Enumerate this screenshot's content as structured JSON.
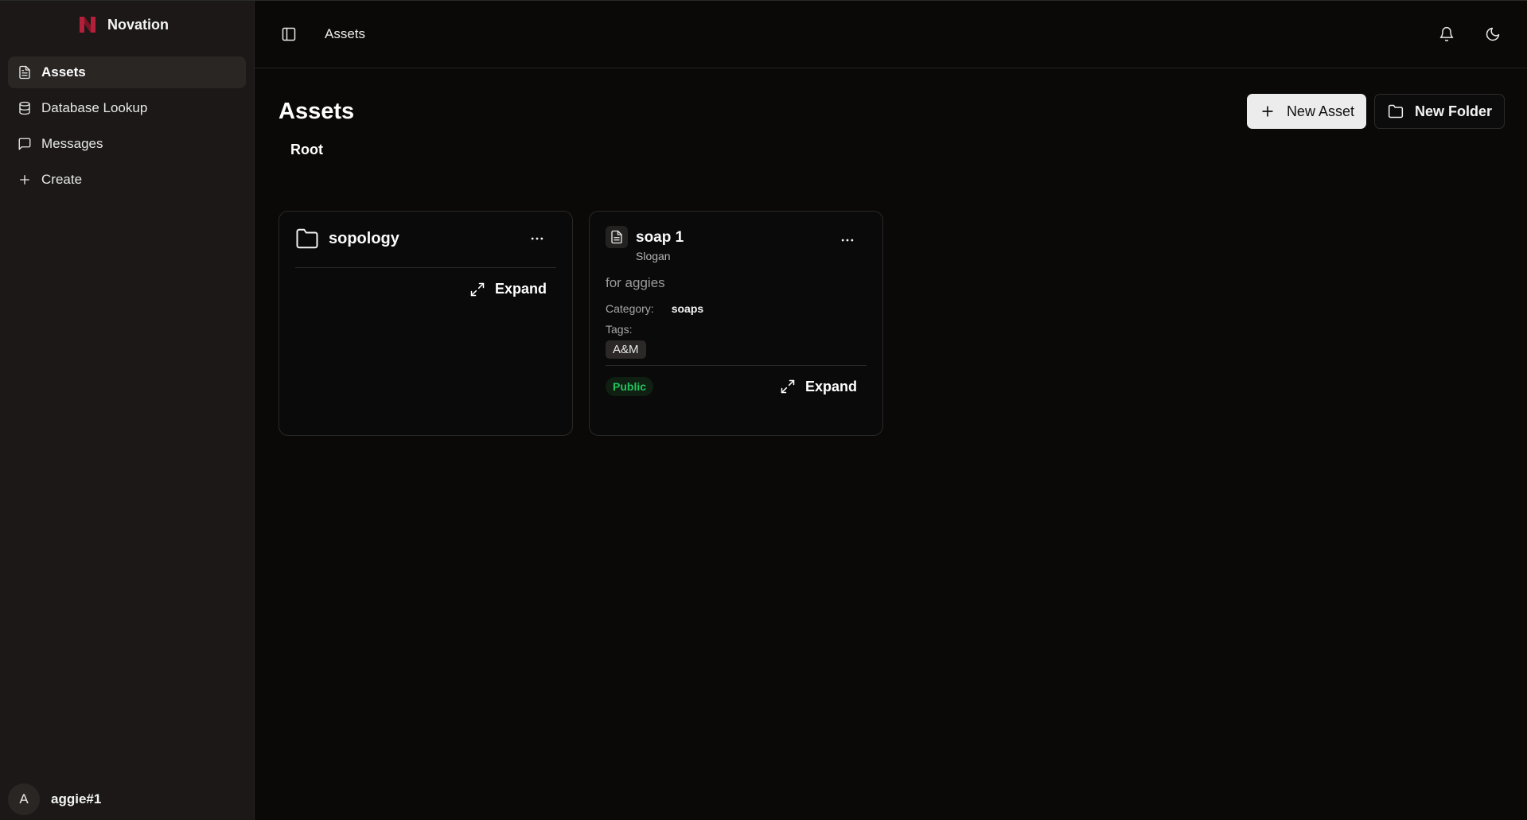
{
  "app": {
    "name": "Novation",
    "brand_color": "#c0213a"
  },
  "sidebar": {
    "items": [
      {
        "label": "Assets",
        "icon": "file-text-icon",
        "active": true
      },
      {
        "label": "Database Lookup",
        "icon": "database-icon",
        "active": false
      },
      {
        "label": "Messages",
        "icon": "message-square-icon",
        "active": false
      },
      {
        "label": "Create",
        "icon": "plus-icon",
        "active": false
      }
    ],
    "user": {
      "avatar_initial": "A",
      "name": "aggie#1"
    }
  },
  "topbar": {
    "breadcrumb": "Assets",
    "icons": [
      "sidebar-toggle-icon",
      "bell-icon",
      "moon-icon"
    ]
  },
  "page": {
    "title": "Assets",
    "new_asset_label": "New Asset",
    "new_folder_label": "New Folder",
    "folder_path": "Root"
  },
  "cards": {
    "folder": {
      "title": "sopology",
      "expand_label": "Expand",
      "icon": "folder-icon"
    },
    "asset": {
      "title": "soap 1",
      "type": "Slogan",
      "description": "for aggies",
      "category_label": "Category:",
      "category": "soaps",
      "tags_label": "Tags:",
      "tags": [
        "A&M"
      ],
      "visibility": "Public",
      "visibility_color": "#22c55e",
      "expand_label": "Expand",
      "icon": "document-icon"
    }
  }
}
